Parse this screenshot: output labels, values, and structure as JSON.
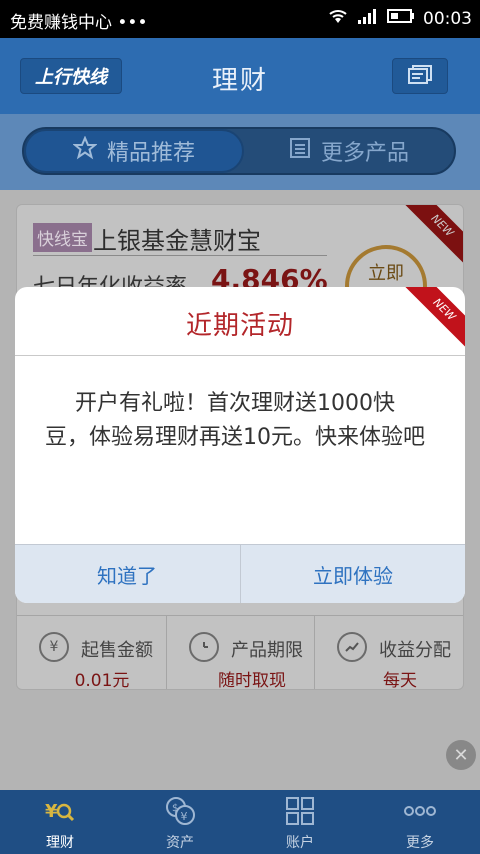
{
  "status_bar": {
    "carrier": "免费赚钱中心 •••",
    "time": "00:03"
  },
  "header": {
    "title": "理财",
    "logo_text": "上行快线"
  },
  "tabs": [
    {
      "label": "精品推荐",
      "icon": "star-icon",
      "active": true
    },
    {
      "label": "更多产品",
      "icon": "list-icon",
      "active": false
    }
  ],
  "product": {
    "tag": "快线宝",
    "name": "上银基金慧财宝",
    "rate_label": "七日年化收益率",
    "rate_value": "4.846%",
    "action_label": "立即",
    "badge": "NEW",
    "stats": [
      {
        "label": "起售金额",
        "value": "0.01元",
        "icon": "yuan-icon"
      },
      {
        "label": "产品期限",
        "value": "随时取现",
        "icon": "clock-icon"
      },
      {
        "label": "收益分配",
        "value": "每天",
        "icon": "trend-icon"
      }
    ]
  },
  "dialog": {
    "title": "近期活动",
    "badge": "NEW",
    "message": "开户有礼啦！首次理财送1000快豆，体验易理财再送10元。快来体验吧",
    "dismiss_label": "知道了",
    "confirm_label": "立即体验"
  },
  "bottom_nav": [
    {
      "label": "理财",
      "icon": "finance-icon",
      "active": true
    },
    {
      "label": "资产",
      "icon": "assets-icon",
      "active": false
    },
    {
      "label": "账户",
      "icon": "account-icon",
      "active": false
    },
    {
      "label": "更多",
      "icon": "more-icon",
      "active": false
    }
  ],
  "colors": {
    "primary": "#2d6cb1",
    "accent_red": "#b3262a",
    "button_text": "#2e72c0"
  }
}
